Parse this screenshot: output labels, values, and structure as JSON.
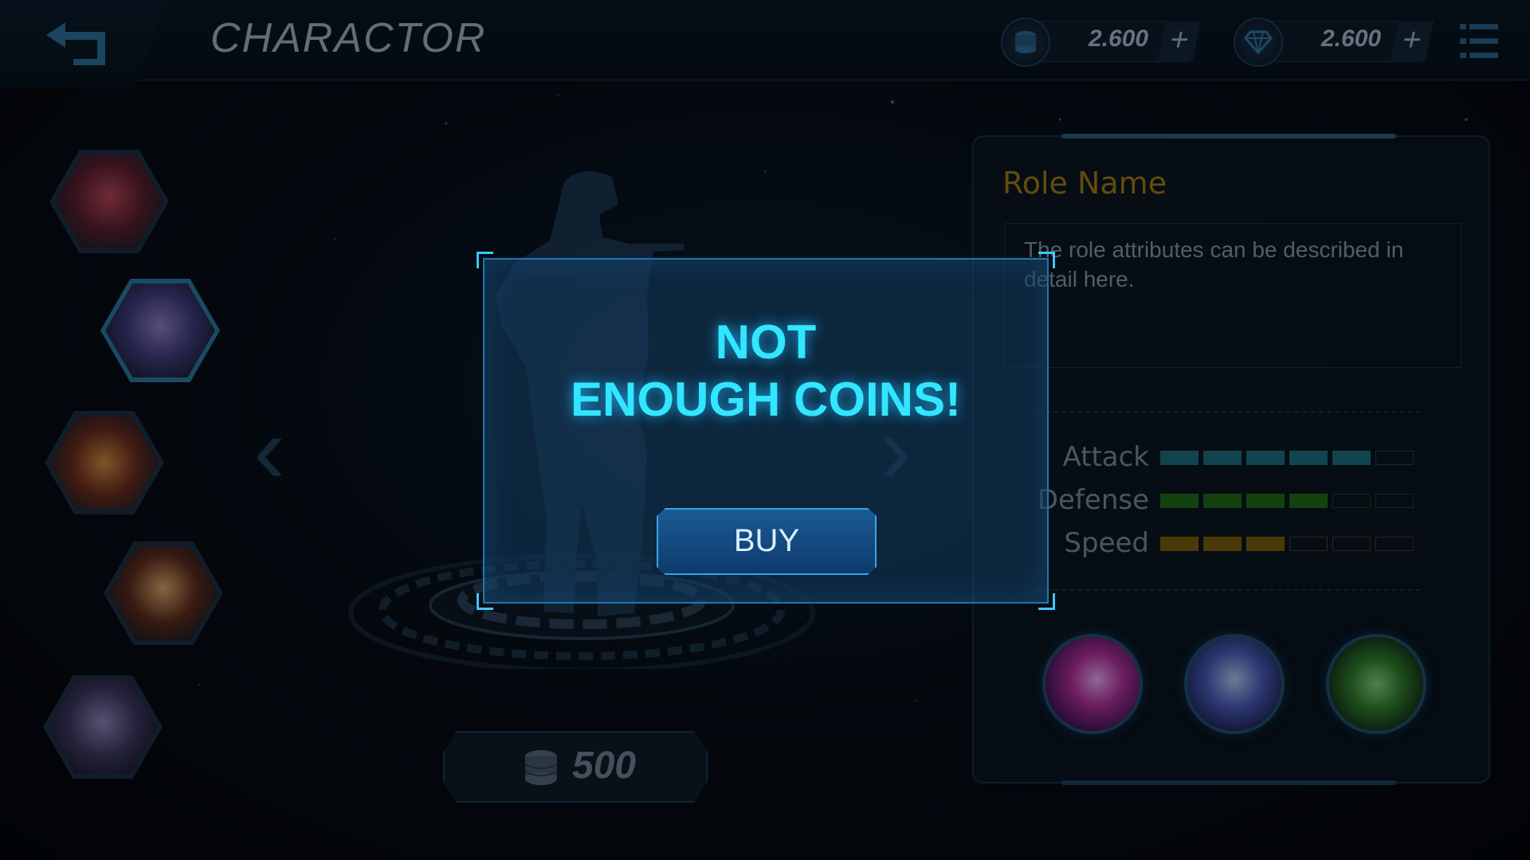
{
  "header": {
    "title": "CHARACTOR",
    "coins": "2.600",
    "gems": "2.600",
    "add_symbol": "+"
  },
  "characters": [
    {
      "name": "character-1",
      "selected": false
    },
    {
      "name": "character-2",
      "selected": true
    },
    {
      "name": "character-3",
      "selected": false
    },
    {
      "name": "character-4",
      "selected": false
    },
    {
      "name": "character-5",
      "selected": false
    }
  ],
  "price": {
    "amount": "500"
  },
  "panel": {
    "role_name": "Role Name",
    "description": "The role attributes can be described in detail here.",
    "stats": [
      {
        "label": "Attack",
        "value": 5,
        "max": 6,
        "color": "#1c6e7e"
      },
      {
        "label": "Defense",
        "value": 4,
        "max": 6,
        "color": "#1f6b1a"
      },
      {
        "label": "Speed",
        "value": 3,
        "max": 6,
        "color": "#7a5e0e"
      }
    ],
    "skills": [
      "lightning-strike-skill",
      "spin-dash-skill",
      "power-fist-skill"
    ]
  },
  "modal": {
    "line1": "NOT",
    "line2": "ENOUGH COINS!",
    "buy_label": "BUY"
  },
  "colors": {
    "accent": "#32e6ff",
    "gold": "#a07b12"
  }
}
